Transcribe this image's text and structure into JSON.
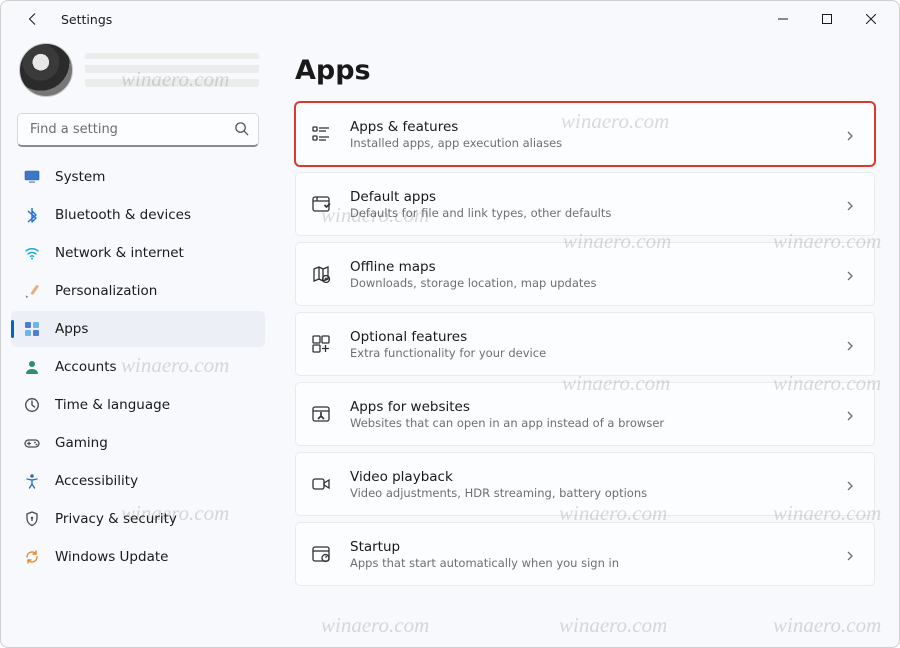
{
  "window": {
    "title": "Settings"
  },
  "search": {
    "placeholder": "Find a setting"
  },
  "nav": {
    "items": [
      {
        "id": "system",
        "label": "System"
      },
      {
        "id": "bluetooth",
        "label": "Bluetooth & devices"
      },
      {
        "id": "network",
        "label": "Network & internet"
      },
      {
        "id": "personalization",
        "label": "Personalization"
      },
      {
        "id": "apps",
        "label": "Apps",
        "active": true
      },
      {
        "id": "accounts",
        "label": "Accounts"
      },
      {
        "id": "time",
        "label": "Time & language"
      },
      {
        "id": "gaming",
        "label": "Gaming"
      },
      {
        "id": "accessibility",
        "label": "Accessibility"
      },
      {
        "id": "privacy",
        "label": "Privacy & security"
      },
      {
        "id": "update",
        "label": "Windows Update"
      }
    ]
  },
  "page": {
    "title": "Apps"
  },
  "cards": [
    {
      "id": "apps-features",
      "title": "Apps & features",
      "sub": "Installed apps, app execution aliases",
      "highlight": true
    },
    {
      "id": "default-apps",
      "title": "Default apps",
      "sub": "Defaults for file and link types, other defaults"
    },
    {
      "id": "offline-maps",
      "title": "Offline maps",
      "sub": "Downloads, storage location, map updates"
    },
    {
      "id": "optional-features",
      "title": "Optional features",
      "sub": "Extra functionality for your device"
    },
    {
      "id": "apps-websites",
      "title": "Apps for websites",
      "sub": "Websites that can open in an app instead of a browser"
    },
    {
      "id": "video-playback",
      "title": "Video playback",
      "sub": "Video adjustments, HDR streaming, battery options"
    },
    {
      "id": "startup",
      "title": "Startup",
      "sub": "Apps that start automatically when you sign in"
    }
  ],
  "watermark": "winaero.com"
}
